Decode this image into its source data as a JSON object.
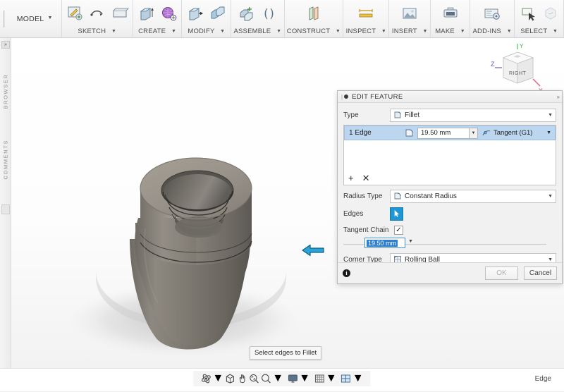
{
  "app": {
    "workspace_label": "MODEL",
    "toolbar_groups": [
      {
        "label": "SKETCH",
        "icons": [
          "create-sketch-icon",
          "line-icon",
          "rectangle-icon"
        ]
      },
      {
        "label": "CREATE",
        "icons": [
          "extrude-icon",
          "sculpt-icon"
        ]
      },
      {
        "label": "MODIFY",
        "icons": [
          "press-pull-icon",
          "combine-icon"
        ]
      },
      {
        "label": "ASSEMBLE",
        "icons": [
          "new-component-icon",
          "joint-icon"
        ]
      },
      {
        "label": "CONSTRUCT",
        "icons": [
          "offset-plane-icon"
        ]
      },
      {
        "label": "INSPECT",
        "icons": [
          "measure-icon"
        ]
      },
      {
        "label": "INSERT",
        "icons": [
          "insert-image-icon"
        ]
      },
      {
        "label": "MAKE",
        "icons": [
          "3d-print-icon"
        ]
      },
      {
        "label": "ADD-INS",
        "icons": [
          "scripts-addins-icon"
        ]
      },
      {
        "label": "SELECT",
        "icons": [
          "select-cursor-icon"
        ]
      }
    ]
  },
  "left_rail": {
    "collapse_label": "»",
    "browser_label": "BROWSER",
    "comments_label": "COMMENTS"
  },
  "viewport": {
    "tooltip": "Select edges to Fillet",
    "viewcube_face": "RIGHT",
    "axis_x": "X",
    "axis_y": "Y",
    "axis_z": "Z"
  },
  "dialog": {
    "title": "EDIT FEATURE",
    "expand_glyph": "»",
    "type_label": "Type",
    "type_value": "Fillet",
    "type_icon": "fillet-icon",
    "edge_row": {
      "name": "1 Edge",
      "radius_icon": "radius-icon",
      "radius_value": "19.50 mm",
      "continuity_icon": "tangent-icon",
      "continuity_value": "Tangent (G1)"
    },
    "edge_tools": {
      "add": "+",
      "remove": "✕"
    },
    "radius_type_label": "Radius Type",
    "radius_type_value": "Constant Radius",
    "radius_type_icon": "constant-radius-icon",
    "edges_label": "Edges",
    "edges_button_icon": "select-cursor-icon",
    "tangent_chain_label": "Tangent Chain",
    "tangent_chain_checked": "✓",
    "manipulator_value": "19.50 mm",
    "corner_type_label": "Corner Type",
    "corner_type_value": "Rolling Ball",
    "corner_type_icon": "rolling-ball-icon",
    "info_glyph": "i",
    "ok_label": "OK",
    "cancel_label": "Cancel"
  },
  "statusbar": {
    "nav_tools": [
      {
        "name": "orbit-icon",
        "has_caret": true
      },
      {
        "name": "look-at-icon",
        "has_caret": false
      },
      {
        "name": "pan-icon",
        "has_caret": false
      },
      {
        "name": "zoom-window-icon",
        "has_caret": false
      },
      {
        "name": "zoom-icon",
        "has_caret": true
      },
      {
        "name": "display-settings-icon",
        "has_caret": true
      },
      {
        "name": "grid-snap-icon",
        "has_caret": true
      },
      {
        "name": "viewports-icon",
        "has_caret": true
      }
    ],
    "selection_filter": "Edge"
  }
}
